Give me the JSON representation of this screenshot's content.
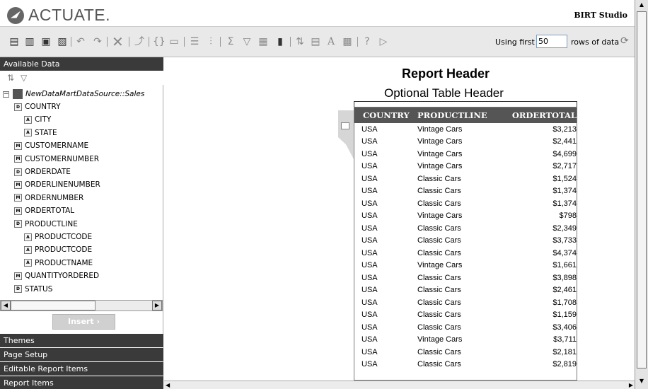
{
  "app": {
    "brand": "ACTUATE.",
    "product": "BIRT Studio"
  },
  "toolbar": {
    "rows_label": "Using first",
    "rows_value": "50",
    "rows_suffix": "rows of data"
  },
  "left_panel": {
    "available_data_label": "Available Data",
    "tree": {
      "source": "NewDataMartDataSource::Sales",
      "items": [
        {
          "label": "COUNTRY",
          "type": "D",
          "level": 1
        },
        {
          "label": "CITY",
          "type": "A",
          "level": 2
        },
        {
          "label": "STATE",
          "type": "A",
          "level": 2
        },
        {
          "label": "CUSTOMERNAME",
          "type": "M",
          "level": 1
        },
        {
          "label": "CUSTOMERNUMBER",
          "type": "M",
          "level": 1
        },
        {
          "label": "ORDERDATE",
          "type": "D",
          "level": 1
        },
        {
          "label": "ORDERLINENUMBER",
          "type": "M",
          "level": 1
        },
        {
          "label": "ORDERNUMBER",
          "type": "M",
          "level": 1
        },
        {
          "label": "ORDERTOTAL",
          "type": "M",
          "level": 1
        },
        {
          "label": "PRODUCTLINE",
          "type": "D",
          "level": 1
        },
        {
          "label": "PRODUCTCODE",
          "type": "A",
          "level": 2
        },
        {
          "label": "PRODUCTCODE",
          "type": "A",
          "level": 2
        },
        {
          "label": "PRODUCTNAME",
          "type": "A",
          "level": 2
        },
        {
          "label": "QUANTITYORDERED",
          "type": "M",
          "level": 1
        },
        {
          "label": "STATUS",
          "type": "D",
          "level": 1
        }
      ]
    },
    "insert_label": "Insert",
    "sections": [
      "Themes",
      "Page Setup",
      "Editable Report Items",
      "Report Items"
    ]
  },
  "report": {
    "header": "Report Header",
    "table_header": "Optional Table Header",
    "columns": [
      "COUNTRY",
      "PRODUCTLINE",
      "ORDERTOTAL"
    ],
    "rows": [
      [
        "USA",
        "Vintage Cars",
        "$3,213"
      ],
      [
        "USA",
        "Vintage Cars",
        "$2,441"
      ],
      [
        "USA",
        "Vintage Cars",
        "$4,699"
      ],
      [
        "USA",
        "Vintage Cars",
        "$2,717"
      ],
      [
        "USA",
        "Classic Cars",
        "$1,524"
      ],
      [
        "USA",
        "Classic Cars",
        "$1,374"
      ],
      [
        "USA",
        "Classic Cars",
        "$1,374"
      ],
      [
        "USA",
        "Vintage Cars",
        "$798"
      ],
      [
        "USA",
        "Classic Cars",
        "$2,349"
      ],
      [
        "USA",
        "Classic Cars",
        "$3,733"
      ],
      [
        "USA",
        "Classic Cars",
        "$4,374"
      ],
      [
        "USA",
        "Vintage Cars",
        "$1,661"
      ],
      [
        "USA",
        "Classic Cars",
        "$3,898"
      ],
      [
        "USA",
        "Classic Cars",
        "$2,461"
      ],
      [
        "USA",
        "Classic Cars",
        "$1,708"
      ],
      [
        "USA",
        "Classic Cars",
        "$1,159"
      ],
      [
        "USA",
        "Classic Cars",
        "$3,406"
      ],
      [
        "USA",
        "Vintage Cars",
        "$3,711"
      ],
      [
        "USA",
        "Classic Cars",
        "$2,181"
      ],
      [
        "USA",
        "Classic Cars",
        "$2,819"
      ]
    ]
  }
}
